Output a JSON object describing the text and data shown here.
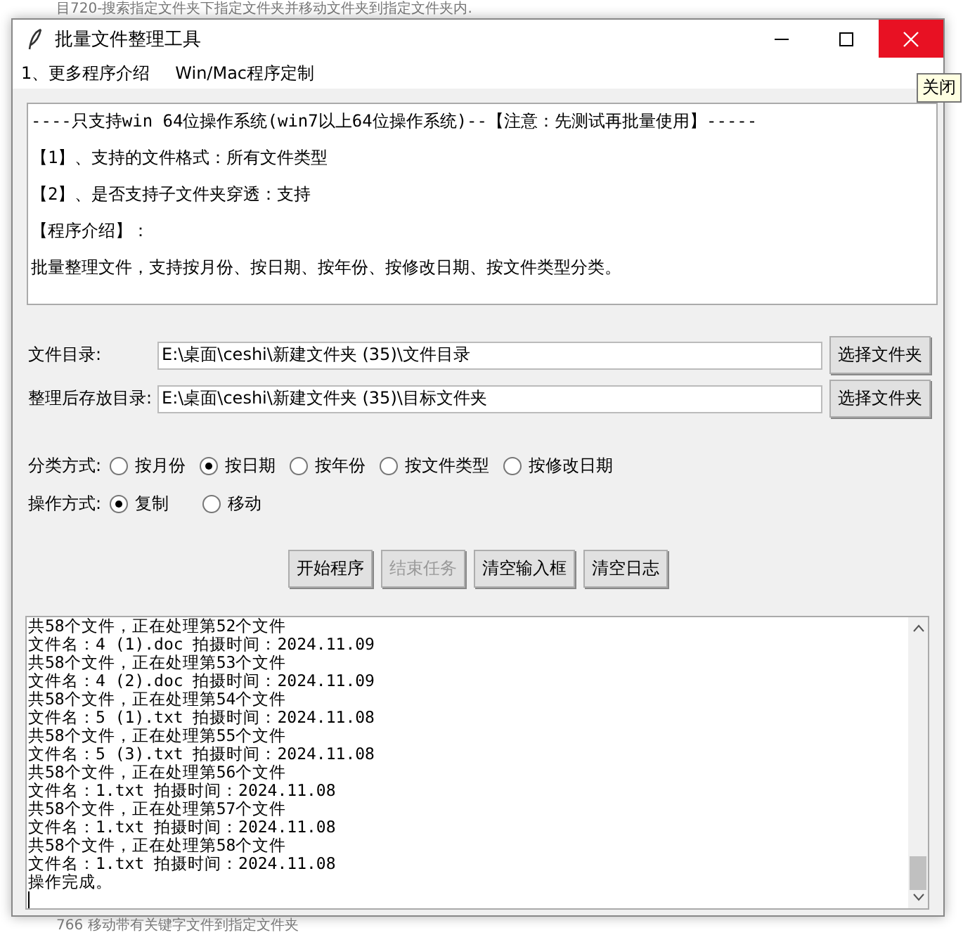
{
  "background": {
    "top_text": "目720-搜索指定文件夹下指定文件夹并移动文件夹到指定文件夹内.",
    "bottom_text": "766 移动带有关键字文件到指定文件夹"
  },
  "window": {
    "title": "批量文件整理工具",
    "tooltip": "关闭"
  },
  "menu": [
    "1、更多程序介绍",
    "Win/Mac程序定制"
  ],
  "intro": [
    "----只支持win 64位操作系统(win7以上64位操作系统)--【注意：先测试再批量使用】-----",
    "【1】、支持的文件格式：所有文件类型",
    "【2】、是否支持子文件夹穿透：支持",
    "【程序介绍】：",
    "批量整理文件，支持按月份、按日期、按年份、按修改日期、按文件类型分类。"
  ],
  "fields": [
    {
      "label": "文件目录:",
      "value": "E:\\桌面\\ceshi\\新建文件夹 (35)\\文件目录",
      "button": "选择文件夹"
    },
    {
      "label": "整理后存放目录:",
      "value": "E:\\桌面\\ceshi\\新建文件夹 (35)\\目标文件夹",
      "button": "选择文件夹"
    }
  ],
  "radio_groups": [
    {
      "label": "分类方式:",
      "options": [
        {
          "label": "按月份",
          "selected": false
        },
        {
          "label": "按日期",
          "selected": true
        },
        {
          "label": "按年份",
          "selected": false
        },
        {
          "label": "按文件类型",
          "selected": false
        },
        {
          "label": "按修改日期",
          "selected": false
        }
      ]
    },
    {
      "label": "操作方式:",
      "options": [
        {
          "label": "复制",
          "selected": true
        },
        {
          "label": "移动",
          "selected": false
        }
      ]
    }
  ],
  "buttons": [
    {
      "label": "开始程序",
      "disabled": false
    },
    {
      "label": "结束任务",
      "disabled": true
    },
    {
      "label": "清空输入框",
      "disabled": false
    },
    {
      "label": "清空日志",
      "disabled": false
    }
  ],
  "log": [
    "共58个文件，正在处理第52个文件",
    "文件名：4 (1).doc 拍摄时间：2024.11.09",
    "共58个文件，正在处理第53个文件",
    "文件名：4 (2).doc 拍摄时间：2024.11.09",
    "共58个文件，正在处理第54个文件",
    "文件名：5 (1).txt 拍摄时间：2024.11.08",
    "共58个文件，正在处理第55个文件",
    "文件名：5 (3).txt 拍摄时间：2024.11.08",
    "共58个文件，正在处理第56个文件",
    "文件名：1.txt 拍摄时间：2024.11.08",
    "共58个文件，正在处理第57个文件",
    "文件名：1.txt 拍摄时间：2024.11.08",
    "共58个文件，正在处理第58个文件",
    "文件名：1.txt 拍摄时间：2024.11.08",
    "操作完成。"
  ]
}
